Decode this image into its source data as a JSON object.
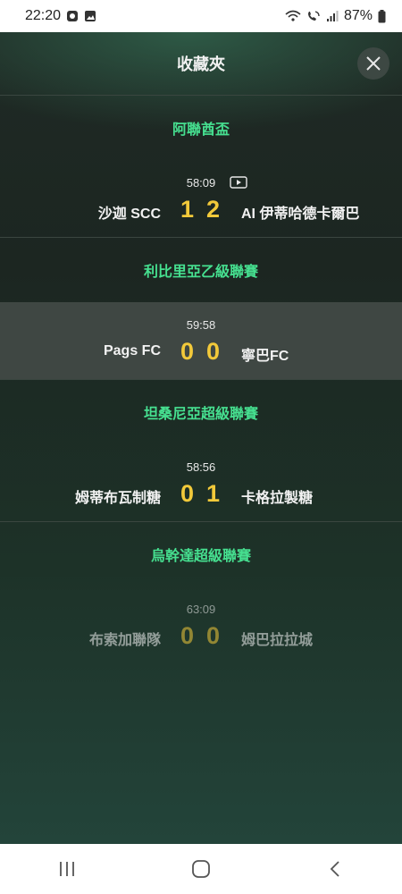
{
  "status_bar": {
    "time": "22:20",
    "battery": "87%"
  },
  "header": {
    "title": "收藏夾"
  },
  "leagues": [
    {
      "name": "阿聯酋盃",
      "matches": [
        {
          "time": "58:09",
          "home": "沙迦 SCC",
          "home_score": "1",
          "away_score": "2",
          "away": "AI 伊蒂哈德卡爾巴",
          "has_video": true
        }
      ]
    },
    {
      "name": "利比里亞乙級聯賽",
      "matches": [
        {
          "time": "59:58",
          "home": "Pags FC",
          "home_score": "0",
          "away_score": "0",
          "away": "寧巴FC"
        }
      ]
    },
    {
      "name": "坦桑尼亞超級聯賽",
      "matches": [
        {
          "time": "58:56",
          "home": "姆蒂布瓦制糖",
          "home_score": "0",
          "away_score": "1",
          "away": "卡格拉製糖"
        }
      ]
    },
    {
      "name": "烏幹達超級聯賽",
      "matches": [
        {
          "time": "63:09",
          "home": "布索加聯隊",
          "home_score": "0",
          "away_score": "0",
          "away": "姆巴拉拉城"
        }
      ]
    }
  ]
}
